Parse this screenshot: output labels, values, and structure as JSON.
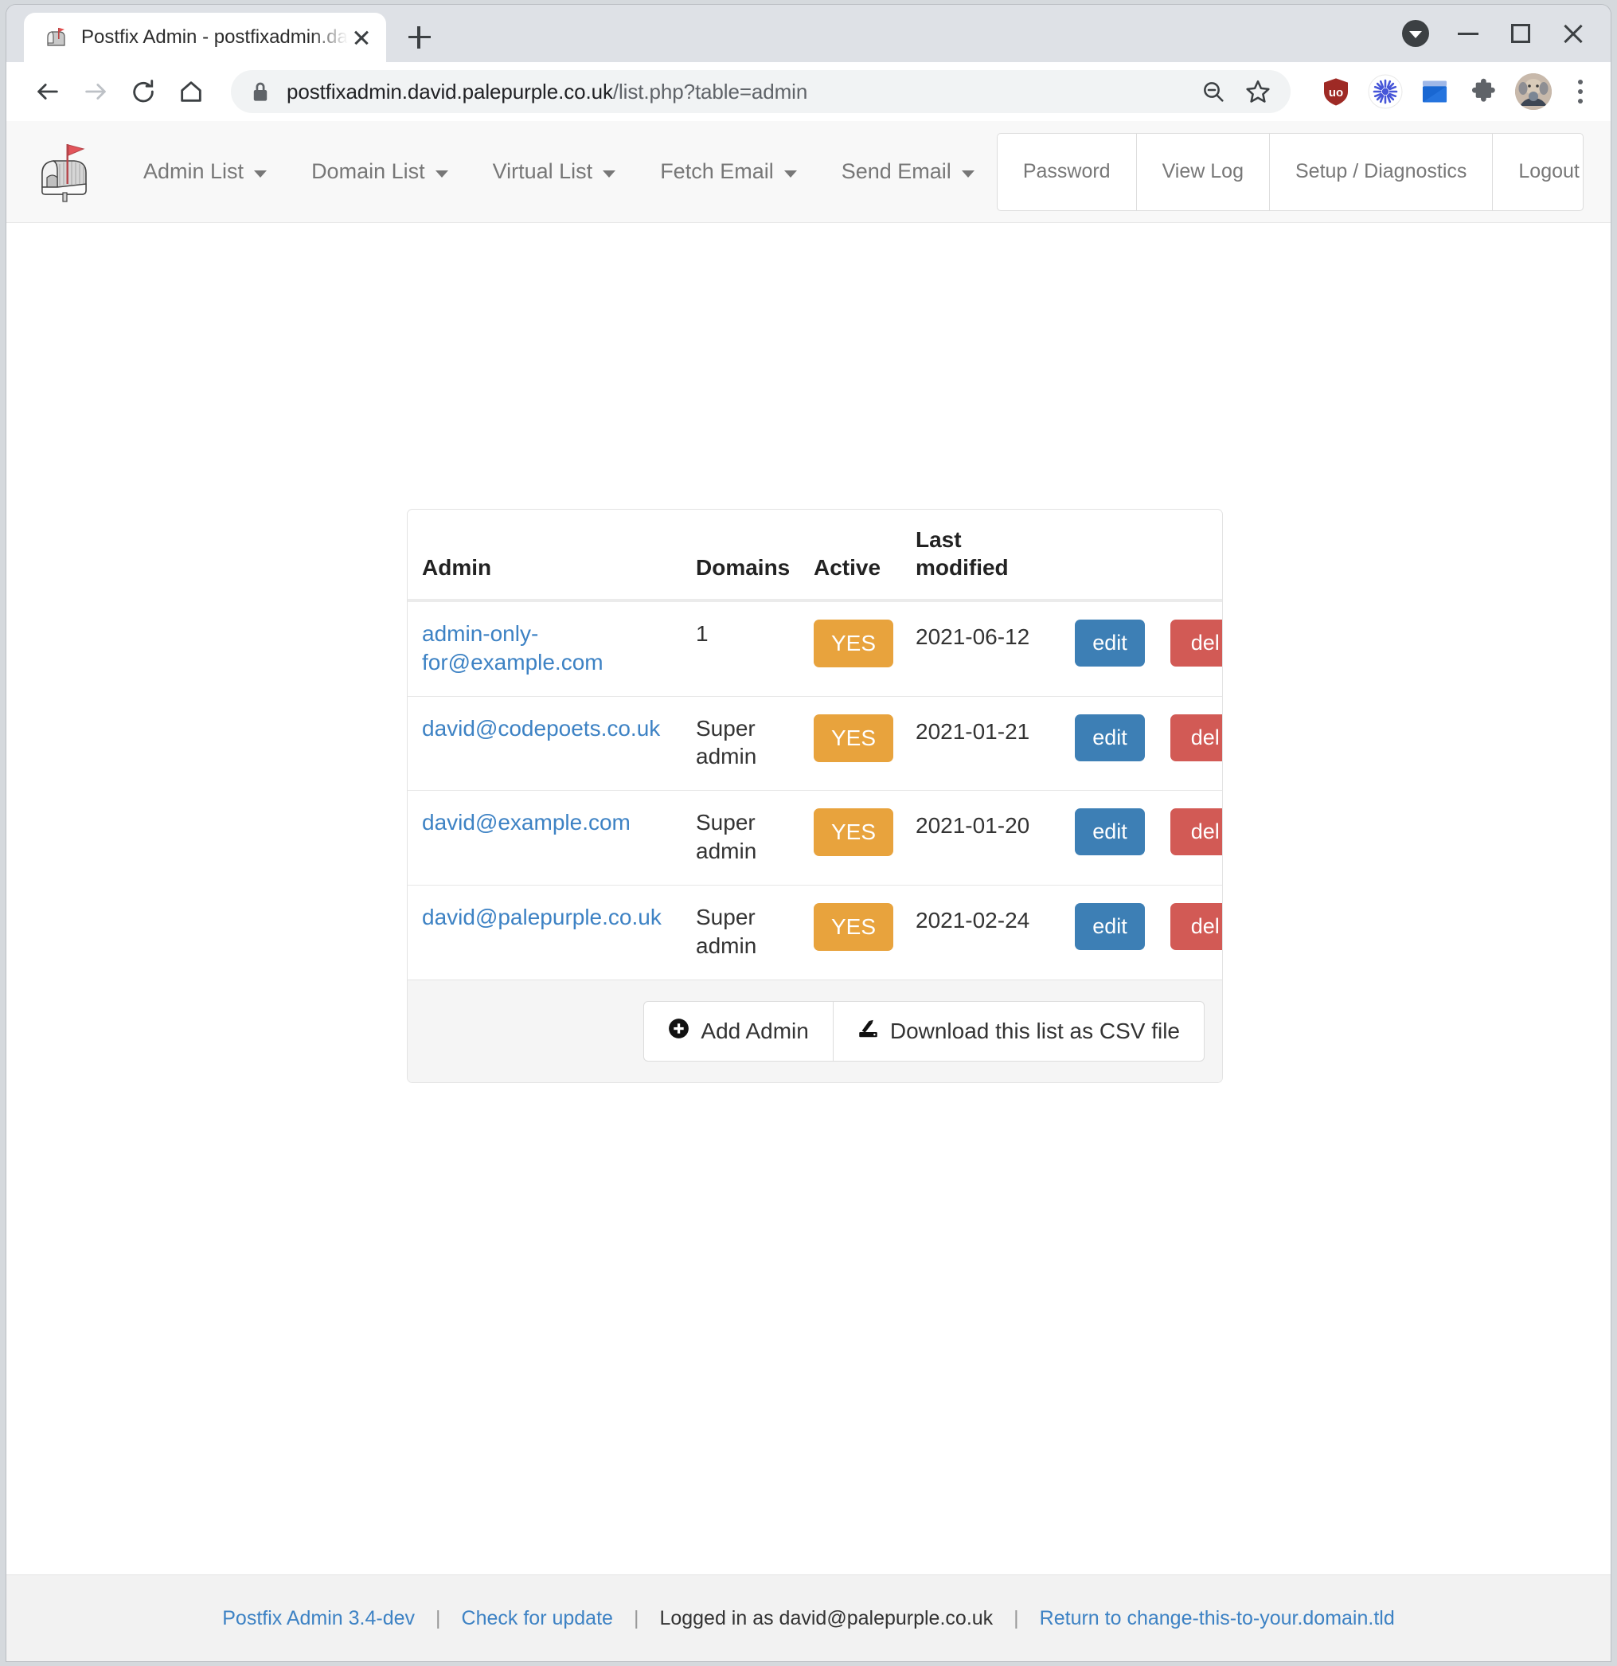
{
  "browser": {
    "tab": {
      "title": "Postfix Admin - postfixadmin.david.palepurple.co.uk",
      "favicon": "mailbox-icon",
      "close": "close-icon"
    },
    "new_tab": "new-tab-icon",
    "window_controls": {
      "tab_search": "tab-search-icon",
      "minimize": "minimize-icon",
      "maximize": "maximize-icon",
      "close": "close-icon"
    },
    "toolbar": {
      "back": "back-arrow-icon",
      "forward": "forward-arrow-icon",
      "reload": "reload-icon",
      "home": "home-icon",
      "lock": "lock-icon",
      "url_domain": "postfixadmin.david.palepurple.co.uk",
      "url_path": "/list.php?table=admin",
      "zoom_out": "zoom-out-icon",
      "bookmark": "star-icon",
      "extensions": [
        "ublock-origin-icon",
        "burst-icon",
        "blue-window-icon",
        "puzzle-piece-icon"
      ],
      "avatar": "profile-avatar",
      "menu": "kebab-menu-icon"
    }
  },
  "site": {
    "brand": "postfix-admin-mailbox-logo",
    "nav_links": [
      {
        "label": "Admin List"
      },
      {
        "label": "Domain List"
      },
      {
        "label": "Virtual List"
      },
      {
        "label": "Fetch Email"
      },
      {
        "label": "Send Email"
      }
    ],
    "nav_right": [
      {
        "label": "Password"
      },
      {
        "label": "View Log"
      },
      {
        "label": "Setup / Diagnostics"
      },
      {
        "label": "Logout"
      }
    ]
  },
  "table": {
    "headers": {
      "admin": "Admin",
      "domains": "Domains",
      "active": "Active",
      "last_modified": "Last modified"
    },
    "rows": [
      {
        "admin": "admin-only-for@example.com",
        "domains": "1",
        "active": "YES",
        "last_modified": "2021-06-12",
        "edit": "edit",
        "del": "del"
      },
      {
        "admin": "david@codepoets.co.uk",
        "domains": "Super admin",
        "active": "YES",
        "last_modified": "2021-01-21",
        "edit": "edit",
        "del": "del"
      },
      {
        "admin": "david@example.com",
        "domains": "Super admin",
        "active": "YES",
        "last_modified": "2021-01-20",
        "edit": "edit",
        "del": "del"
      },
      {
        "admin": "david@palepurple.co.uk",
        "domains": "Super admin",
        "active": "YES",
        "last_modified": "2021-02-24",
        "edit": "edit",
        "del": "del"
      }
    ],
    "footer_buttons": {
      "add_admin": "Add Admin",
      "add_admin_icon": "plus-circle-icon",
      "download_csv": "Download this list as CSV file",
      "download_csv_icon": "save-download-icon"
    }
  },
  "page_footer": {
    "version": "Postfix Admin 3.4-dev",
    "check_update": "Check for update",
    "logged_in": "Logged in as david@palepurple.co.uk",
    "return_link": "Return to change-this-to-your.domain.tld",
    "separator": "|"
  },
  "colors": {
    "link": "#3d82c4",
    "badge_active": "#e8a33d",
    "edit_button": "#3d7fb5",
    "del_button": "#d25a55",
    "navbar_bg": "#f8f8f8",
    "footer_bg": "#f2f2f2"
  }
}
